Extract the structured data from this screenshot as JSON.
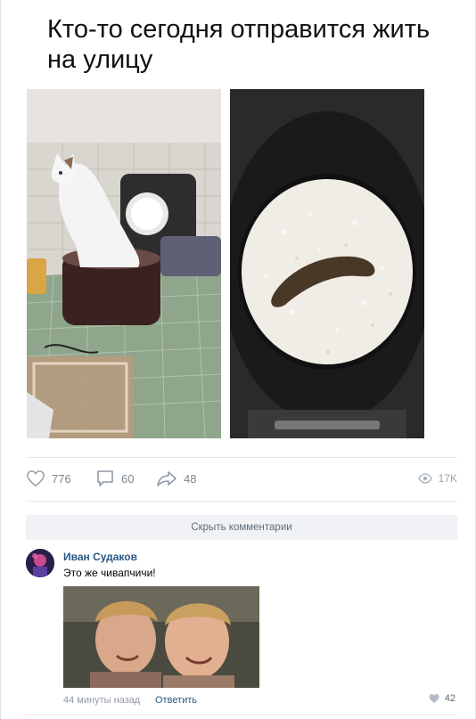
{
  "post": {
    "title": "Кто-то сегодня отправится жить на улицу",
    "actions": {
      "likes": "776",
      "comments": "60",
      "shares": "48",
      "views": "17K"
    }
  },
  "comments_toggle": "Скрыть комментарии",
  "comment": {
    "author": "Иван Судаков",
    "text": "Это же чивапчичи!",
    "time": "44 минуты назад",
    "reply_label": "Ответить",
    "likes": "42"
  },
  "icons": {
    "like": "heart-icon",
    "comment": "speech-bubble-icon",
    "share": "share-arrow-icon",
    "views": "eye-icon"
  },
  "colors": {
    "link": "#2a5885",
    "muted": "#7c8591",
    "toggle_bg": "#f0f2f5"
  }
}
